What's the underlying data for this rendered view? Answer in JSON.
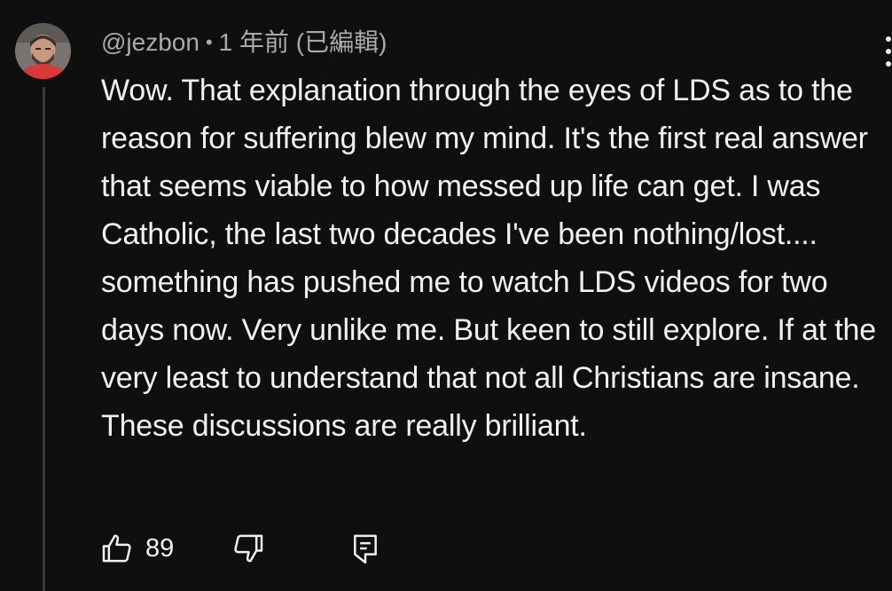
{
  "comment": {
    "author": "@jezbon",
    "separator": "•",
    "time": "1 年前",
    "edited": "(已編輯)",
    "text": "Wow. That explanation through the eyes of LDS as to the reason for suffering blew my mind. It's the first real answer that seems viable to how messed up life can get. I was Catholic, the last two decades I've been nothing/lost.... something has pushed me to watch LDS videos for two days now. Very unlike me. But keen to still explore. If at the very least to understand that not all Christians are insane. These discussions are really brilliant.",
    "like_count": "89"
  },
  "icons": {
    "avatar": "avatar-photo",
    "like": "thumbs-up-icon",
    "dislike": "thumbs-down-icon",
    "reply": "reply-comment-icon",
    "menu": "vertical-dots-icon"
  },
  "colors": {
    "background": "#0f0f0f",
    "text_primary": "#f1f1f1",
    "text_secondary": "#aaaaaa",
    "thread_line": "#3a3a3a"
  }
}
